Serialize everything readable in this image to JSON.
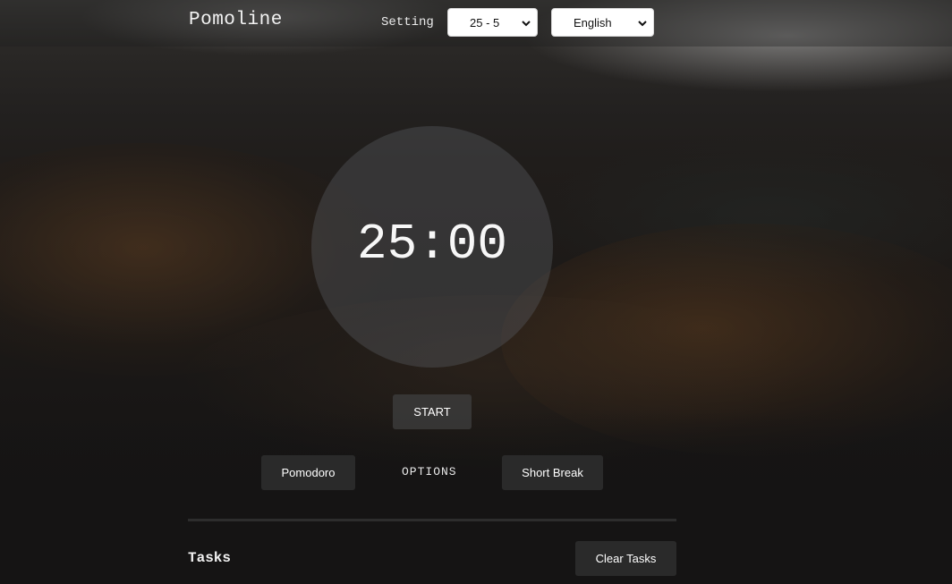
{
  "app": {
    "title": "Pomoline"
  },
  "header": {
    "setting_label": "Setting",
    "session_select": {
      "value": "25 - 5"
    },
    "language_select": {
      "value": "English"
    }
  },
  "timer": {
    "display": "25:00",
    "start_label": "START"
  },
  "modes": {
    "pomodoro_label": "Pomodoro",
    "options_label": "OPTIONS",
    "short_break_label": "Short Break"
  },
  "tasks": {
    "title": "Tasks",
    "clear_label": "Clear Tasks"
  },
  "colors": {
    "page_background": "#151414",
    "button_background": "#2a2a2a",
    "timer_circle": "#56585c",
    "text": "#ffffff"
  },
  "icons": {
    "select_arrow": "chevron-down-icon"
  }
}
